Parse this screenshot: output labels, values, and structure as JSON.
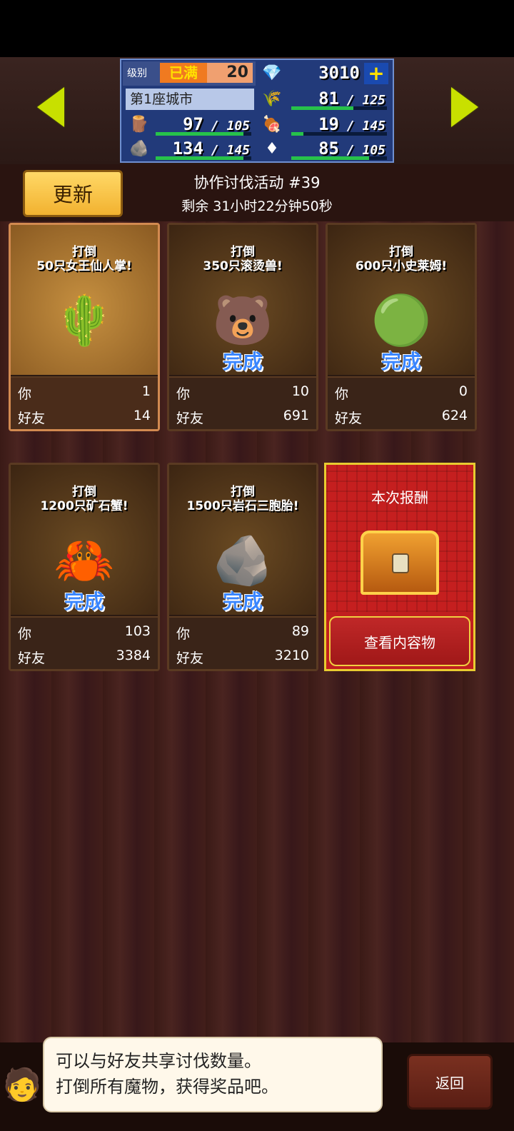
{
  "stats": {
    "level_label": "级别",
    "level_tag": "已满",
    "level_value": "20",
    "gems": "3010",
    "city": "第1座城市",
    "grass": {
      "value": "81",
      "max": "125",
      "fill_pct": 65
    },
    "wood": {
      "value": "97",
      "max": "105",
      "fill_pct": 92
    },
    "food": {
      "value": "19",
      "max": "145",
      "fill_pct": 13
    },
    "stone": {
      "value": "134",
      "max": "145",
      "fill_pct": 92
    },
    "ruby": {
      "value": "85",
      "max": "105",
      "fill_pct": 81
    }
  },
  "header": {
    "refresh_label": "更新",
    "event_title": "协作讨伐活动 #39",
    "remaining": "剩余 31小时22分钟50秒"
  },
  "cards": [
    {
      "task": "打倒\n50只女王仙人掌!",
      "monster": "🌵",
      "done": "",
      "you_label": "你",
      "you": "1",
      "friends_label": "好友",
      "friends": "14"
    },
    {
      "task": "打倒\n350只滚烫兽!",
      "monster": "🐻",
      "done": "完成",
      "you_label": "你",
      "you": "10",
      "friends_label": "好友",
      "friends": "691"
    },
    {
      "task": "打倒\n600只小史莱姆!",
      "monster": "🟢",
      "done": "完成",
      "you_label": "你",
      "you": "0",
      "friends_label": "好友",
      "friends": "624"
    },
    {
      "task": "打倒\n1200只矿石蟹!",
      "monster": "🦀",
      "done": "完成",
      "you_label": "你",
      "you": "103",
      "friends_label": "好友",
      "friends": "3384"
    },
    {
      "task": "打倒\n1500只岩石三胞胎!",
      "monster": "🪨",
      "done": "完成",
      "you_label": "你",
      "you": "89",
      "friends_label": "好友",
      "friends": "3210"
    }
  ],
  "reward": {
    "title": "本次报酬",
    "button": "查看内容物"
  },
  "footer": {
    "message_line1": "可以与好友共享讨伐数量。",
    "message_line2": "打倒所有魔物，获得奖品吧。",
    "back": "返回"
  }
}
